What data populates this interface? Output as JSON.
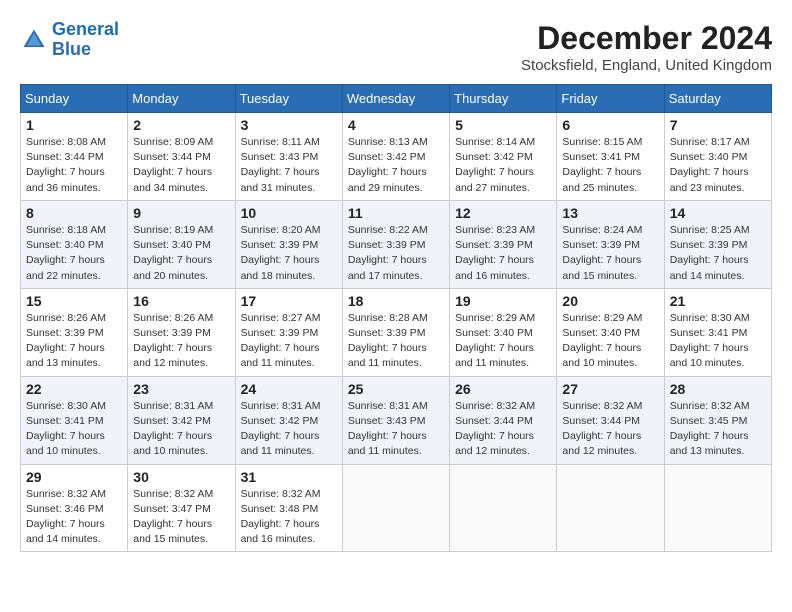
{
  "header": {
    "logo_line1": "General",
    "logo_line2": "Blue",
    "month_year": "December 2024",
    "location": "Stocksfield, England, United Kingdom"
  },
  "calendar": {
    "headers": [
      "Sunday",
      "Monday",
      "Tuesday",
      "Wednesday",
      "Thursday",
      "Friday",
      "Saturday"
    ],
    "weeks": [
      [
        null,
        {
          "day": "2",
          "sunrise": "8:09 AM",
          "sunset": "3:44 PM",
          "daylight": "7 hours and 34 minutes."
        },
        {
          "day": "3",
          "sunrise": "8:11 AM",
          "sunset": "3:43 PM",
          "daylight": "7 hours and 31 minutes."
        },
        {
          "day": "4",
          "sunrise": "8:13 AM",
          "sunset": "3:42 PM",
          "daylight": "7 hours and 29 minutes."
        },
        {
          "day": "5",
          "sunrise": "8:14 AM",
          "sunset": "3:42 PM",
          "daylight": "7 hours and 27 minutes."
        },
        {
          "day": "6",
          "sunrise": "8:15 AM",
          "sunset": "3:41 PM",
          "daylight": "7 hours and 25 minutes."
        },
        {
          "day": "7",
          "sunrise": "8:17 AM",
          "sunset": "3:40 PM",
          "daylight": "7 hours and 23 minutes."
        }
      ],
      [
        {
          "day": "1",
          "sunrise": "8:08 AM",
          "sunset": "3:44 PM",
          "daylight": "7 hours and 36 minutes."
        },
        {
          "day": "8",
          "sunrise": "8:18 AM",
          "sunset": "3:40 PM",
          "daylight": "7 hours and 22 minutes."
        },
        {
          "day": "9",
          "sunrise": "8:19 AM",
          "sunset": "3:40 PM",
          "daylight": "7 hours and 20 minutes."
        },
        {
          "day": "10",
          "sunrise": "8:20 AM",
          "sunset": "3:39 PM",
          "daylight": "7 hours and 18 minutes."
        },
        {
          "day": "11",
          "sunrise": "8:22 AM",
          "sunset": "3:39 PM",
          "daylight": "7 hours and 17 minutes."
        },
        {
          "day": "12",
          "sunrise": "8:23 AM",
          "sunset": "3:39 PM",
          "daylight": "7 hours and 16 minutes."
        },
        {
          "day": "13",
          "sunrise": "8:24 AM",
          "sunset": "3:39 PM",
          "daylight": "7 hours and 15 minutes."
        },
        {
          "day": "14",
          "sunrise": "8:25 AM",
          "sunset": "3:39 PM",
          "daylight": "7 hours and 14 minutes."
        }
      ],
      [
        {
          "day": "15",
          "sunrise": "8:26 AM",
          "sunset": "3:39 PM",
          "daylight": "7 hours and 13 minutes."
        },
        {
          "day": "16",
          "sunrise": "8:26 AM",
          "sunset": "3:39 PM",
          "daylight": "7 hours and 12 minutes."
        },
        {
          "day": "17",
          "sunrise": "8:27 AM",
          "sunset": "3:39 PM",
          "daylight": "7 hours and 11 minutes."
        },
        {
          "day": "18",
          "sunrise": "8:28 AM",
          "sunset": "3:39 PM",
          "daylight": "7 hours and 11 minutes."
        },
        {
          "day": "19",
          "sunrise": "8:29 AM",
          "sunset": "3:40 PM",
          "daylight": "7 hours and 11 minutes."
        },
        {
          "day": "20",
          "sunrise": "8:29 AM",
          "sunset": "3:40 PM",
          "daylight": "7 hours and 10 minutes."
        },
        {
          "day": "21",
          "sunrise": "8:30 AM",
          "sunset": "3:41 PM",
          "daylight": "7 hours and 10 minutes."
        }
      ],
      [
        {
          "day": "22",
          "sunrise": "8:30 AM",
          "sunset": "3:41 PM",
          "daylight": "7 hours and 10 minutes."
        },
        {
          "day": "23",
          "sunrise": "8:31 AM",
          "sunset": "3:42 PM",
          "daylight": "7 hours and 10 minutes."
        },
        {
          "day": "24",
          "sunrise": "8:31 AM",
          "sunset": "3:42 PM",
          "daylight": "7 hours and 11 minutes."
        },
        {
          "day": "25",
          "sunrise": "8:31 AM",
          "sunset": "3:43 PM",
          "daylight": "7 hours and 11 minutes."
        },
        {
          "day": "26",
          "sunrise": "8:32 AM",
          "sunset": "3:44 PM",
          "daylight": "7 hours and 12 minutes."
        },
        {
          "day": "27",
          "sunrise": "8:32 AM",
          "sunset": "3:44 PM",
          "daylight": "7 hours and 12 minutes."
        },
        {
          "day": "28",
          "sunrise": "8:32 AM",
          "sunset": "3:45 PM",
          "daylight": "7 hours and 13 minutes."
        }
      ],
      [
        {
          "day": "29",
          "sunrise": "8:32 AM",
          "sunset": "3:46 PM",
          "daylight": "7 hours and 14 minutes."
        },
        {
          "day": "30",
          "sunrise": "8:32 AM",
          "sunset": "3:47 PM",
          "daylight": "7 hours and 15 minutes."
        },
        {
          "day": "31",
          "sunrise": "8:32 AM",
          "sunset": "3:48 PM",
          "daylight": "7 hours and 16 minutes."
        },
        null,
        null,
        null,
        null
      ]
    ],
    "week1_sunday": {
      "day": "1",
      "sunrise": "8:08 AM",
      "sunset": "3:44 PM",
      "daylight": "7 hours and 36 minutes."
    }
  }
}
